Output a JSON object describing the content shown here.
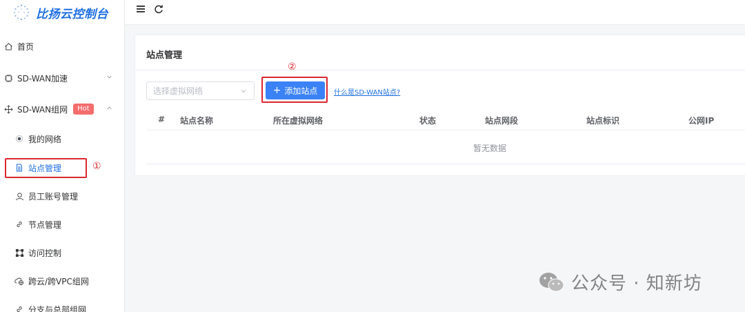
{
  "app": {
    "title": "比扬云控制台"
  },
  "sidebar": {
    "items": [
      {
        "label": "首页",
        "icon": "home-icon"
      },
      {
        "label": "SD-WAN加速",
        "icon": "chip-icon"
      },
      {
        "label": "SD-WAN组网",
        "icon": "network-move-icon",
        "badge": "Hot"
      },
      {
        "label": "我的网络",
        "icon": "radio-dot-icon"
      },
      {
        "label": "站点管理",
        "icon": "document-icon"
      },
      {
        "label": "员工账号管理",
        "icon": "user-icon"
      },
      {
        "label": "节点管理",
        "icon": "link-icon"
      },
      {
        "label": "访问控制",
        "icon": "nodes-icon"
      },
      {
        "label": "跨云/跨VPC组网",
        "icon": "cloud-globe-icon"
      },
      {
        "label": "分支与总部组网",
        "icon": "link-icon"
      }
    ]
  },
  "annotations": {
    "marker_1": "①",
    "marker_2": "②"
  },
  "card": {
    "title": "站点管理",
    "select_placeholder": "选择虚拟网络",
    "add_button": "添加站点",
    "add_plus": "+",
    "help_link": "什么是SD-WAN站点?",
    "columns": [
      "#",
      "站点名称",
      "所在虚拟网络",
      "状态",
      "站点网段",
      "站点标识",
      "公网IP"
    ],
    "empty_text": "暂无数据"
  },
  "watermark": {
    "text": "公众号 · 知新坊"
  },
  "colors": {
    "accent": "#1e6fe0",
    "button": "#3b82f6",
    "badge": "#f56c6c",
    "highlight": "#d9272e"
  }
}
